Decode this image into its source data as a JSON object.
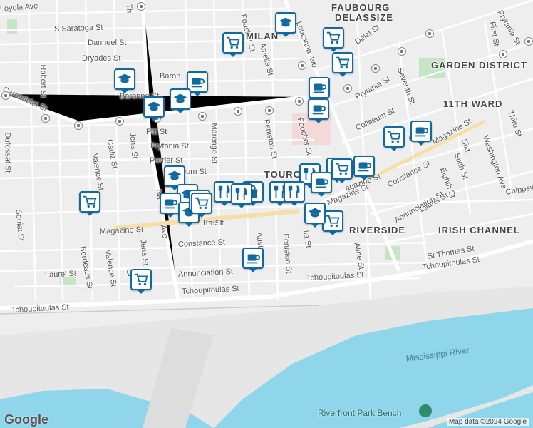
{
  "map": {
    "street_labels": [
      {
        "text": "Loyola Ave"
      },
      {
        "text": "S Saratoga St"
      },
      {
        "text": "Danneel St"
      },
      {
        "text": "Dryades St"
      },
      {
        "text": "Baron"
      },
      {
        "text": "Baronne St"
      },
      {
        "text": "Carondelet St"
      },
      {
        "text": "Pitt St"
      },
      {
        "text": "Prytania St"
      },
      {
        "text": "Perrier St"
      },
      {
        "text": "eum St"
      },
      {
        "text": "Marengo St"
      },
      {
        "text": "Amelia St"
      },
      {
        "text": "Peniston St"
      },
      {
        "text": "Foucher St"
      },
      {
        "text": "Louisiana Ave"
      },
      {
        "text": "Prytania St"
      },
      {
        "text": "Coliseum St"
      },
      {
        "text": "Magazine St"
      },
      {
        "text": "Magazine St"
      },
      {
        "text": "Magazine St"
      },
      {
        "text": "Constance St"
      },
      {
        "text": "Constance St"
      },
      {
        "text": "Laurel St"
      },
      {
        "text": "Laurel St"
      },
      {
        "text": "Annunciation St"
      },
      {
        "text": "Annunciation St"
      },
      {
        "text": "Tchoupitoulas St"
      },
      {
        "text": "Tchoupitoulas St"
      },
      {
        "text": "Tchoupitoulas St"
      },
      {
        "text": "Tchoupitoulas St"
      },
      {
        "text": "St Thomas St"
      },
      {
        "text": "Seventh St"
      },
      {
        "text": "Eighth St"
      },
      {
        "text": "Sixth St"
      },
      {
        "text": "Washington Ave"
      },
      {
        "text": "Third St"
      },
      {
        "text": "First St"
      },
      {
        "text": "Prytania St"
      },
      {
        "text": "Chippew"
      },
      {
        "text": "Robert St"
      },
      {
        "text": "Dufossat St"
      },
      {
        "text": "Soniat St"
      },
      {
        "text": "Bordeaux St"
      },
      {
        "text": "Valence St"
      },
      {
        "text": "Valence St"
      },
      {
        "text": "Cadiz St"
      },
      {
        "text": "Jena St"
      },
      {
        "text": "Jena St"
      },
      {
        "text": "Aline St"
      },
      {
        "text": "Peniston St"
      },
      {
        "text": "Auster"
      },
      {
        "text": "Che"
      },
      {
        "text": "Sixt"
      },
      {
        "text": "lia St"
      },
      {
        "text": "Delet St"
      },
      {
        "text": "Foucher St"
      },
      {
        "text": "Ave"
      },
      {
        "text": "Na"
      },
      {
        "text": "ine St"
      },
      {
        "text": "Cl"
      },
      {
        "text": "Thi"
      },
      {
        "text": "Ea St"
      },
      {
        "text": "agazine St"
      }
    ],
    "area_labels": [
      {
        "text": "FAUBOURG"
      },
      {
        "text": "DELASSIZE"
      },
      {
        "text": "MILAN"
      },
      {
        "text": "GARDEN DISTRICT"
      },
      {
        "text": "11TH WARD"
      },
      {
        "text": "TOURO"
      },
      {
        "text": "RIVERSIDE"
      },
      {
        "text": "IRISH CHANNEL"
      }
    ],
    "water_label": "Mississippi River",
    "poi_label": "Riverfront Park Bench",
    "logo": "Google",
    "attribution": "Map data ©2024 Google"
  },
  "markers": [
    {
      "type": "school",
      "icon": "school-icon"
    },
    {
      "type": "grocery",
      "icon": "cart-icon"
    },
    {
      "type": "grocery",
      "icon": "cart-icon"
    },
    {
      "type": "grocery",
      "icon": "cart-icon"
    },
    {
      "type": "school",
      "icon": "school-icon"
    },
    {
      "type": "cafe",
      "icon": "cup-icon"
    },
    {
      "type": "school",
      "icon": "school-icon"
    },
    {
      "type": "school",
      "icon": "school-icon"
    },
    {
      "type": "cafe",
      "icon": "cup-icon"
    },
    {
      "type": "cafe",
      "icon": "cup-icon"
    },
    {
      "type": "grocery",
      "icon": "cart-icon"
    },
    {
      "type": "cafe",
      "icon": "cup-icon"
    },
    {
      "type": "grocery",
      "icon": "cart-icon"
    },
    {
      "type": "cafe",
      "icon": "cup-icon"
    },
    {
      "type": "restaurant",
      "icon": "fork-knife-icon"
    },
    {
      "type": "grocery",
      "icon": "cart-icon"
    },
    {
      "type": "cafe",
      "icon": "cup-icon"
    },
    {
      "type": "school",
      "icon": "school-icon"
    },
    {
      "type": "grocery",
      "icon": "cart-icon"
    },
    {
      "type": "school",
      "icon": "school-icon"
    },
    {
      "type": "cafe",
      "icon": "cup-icon"
    },
    {
      "type": "school",
      "icon": "school-icon"
    },
    {
      "type": "grocery",
      "icon": "cart-icon"
    },
    {
      "type": "restaurant",
      "icon": "fork-knife-icon"
    },
    {
      "type": "shopping",
      "icon": "bag-icon"
    },
    {
      "type": "restaurant",
      "icon": "fork-knife-icon"
    },
    {
      "type": "restaurant",
      "icon": "fork-knife-icon"
    },
    {
      "type": "restaurant",
      "icon": "fork-knife-icon"
    },
    {
      "type": "cafe",
      "icon": "cup-icon"
    },
    {
      "type": "school",
      "icon": "school-icon"
    },
    {
      "type": "grocery",
      "icon": "cart-icon"
    },
    {
      "type": "cafe",
      "icon": "cup-icon"
    },
    {
      "type": "grocery",
      "icon": "cart-icon"
    }
  ],
  "colors": {
    "marker_border": "#0e6aa0",
    "water": "#8fd6ea",
    "park": "#c6e5c4",
    "highway": "#f6dfa6"
  }
}
